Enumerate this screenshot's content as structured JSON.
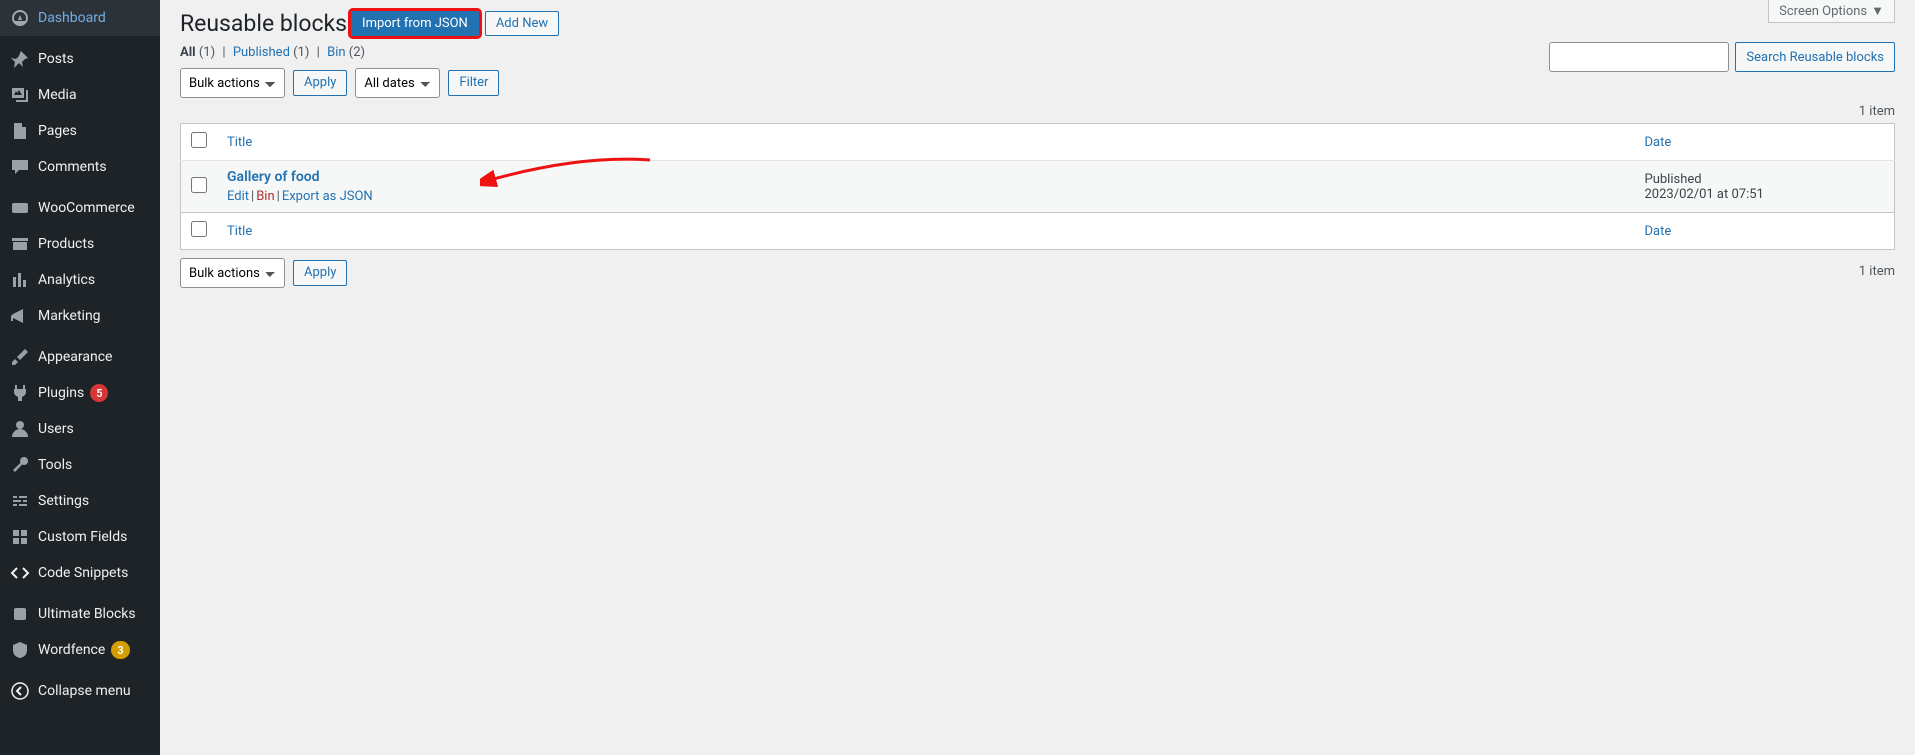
{
  "sidebar": {
    "items": [
      {
        "label": "Dashboard",
        "icon": "dashboard"
      },
      {
        "label": "Posts",
        "icon": "pin"
      },
      {
        "label": "Media",
        "icon": "media"
      },
      {
        "label": "Pages",
        "icon": "page"
      },
      {
        "label": "Comments",
        "icon": "comment"
      },
      {
        "label": "WooCommerce",
        "icon": "woo"
      },
      {
        "label": "Products",
        "icon": "archive"
      },
      {
        "label": "Analytics",
        "icon": "chart"
      },
      {
        "label": "Marketing",
        "icon": "megaphone"
      },
      {
        "label": "Appearance",
        "icon": "brush"
      },
      {
        "label": "Plugins",
        "icon": "plug",
        "badge": "5",
        "badgeClass": "red"
      },
      {
        "label": "Users",
        "icon": "users"
      },
      {
        "label": "Tools",
        "icon": "wrench"
      },
      {
        "label": "Settings",
        "icon": "sliders"
      },
      {
        "label": "Custom Fields",
        "icon": "grid"
      },
      {
        "label": "Code Snippets",
        "icon": "code"
      },
      {
        "label": "Ultimate Blocks",
        "icon": "blocks"
      },
      {
        "label": "Wordfence",
        "icon": "shield",
        "badge": "3",
        "badgeClass": "orange"
      },
      {
        "label": "Collapse menu",
        "icon": "collapse"
      }
    ]
  },
  "header": {
    "title": "Reusable blocks",
    "import_btn": "Import from JSON",
    "add_new_btn": "Add New",
    "screen_options": "Screen Options"
  },
  "filters": {
    "all_label": "All",
    "all_count": "(1)",
    "published_label": "Published",
    "published_count": "(1)",
    "bin_label": "Bin",
    "bin_count": "(2)"
  },
  "controls": {
    "bulk_actions": "Bulk actions",
    "apply": "Apply",
    "all_dates": "All dates",
    "filter": "Filter",
    "item_count": "1 item",
    "search_placeholder": "",
    "search_btn": "Search Reusable blocks"
  },
  "table": {
    "th_title": "Title",
    "th_date": "Date",
    "rows": [
      {
        "title": "Gallery of food",
        "status": "Published",
        "date": "2023/02/01 at 07:51",
        "actions": {
          "edit": "Edit",
          "bin": "Bin",
          "export": "Export as JSON"
        }
      }
    ]
  }
}
